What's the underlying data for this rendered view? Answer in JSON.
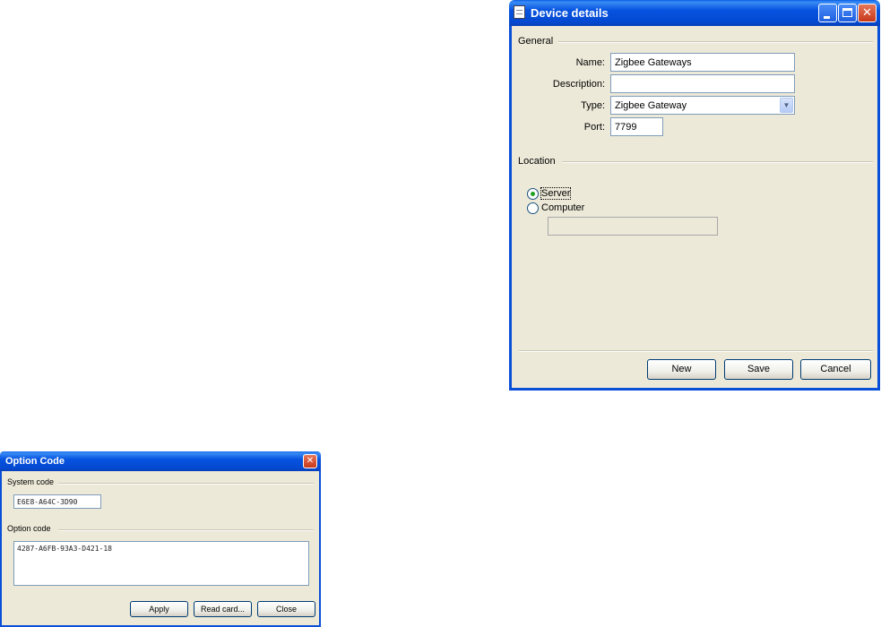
{
  "device_window": {
    "title": "Device details",
    "icon": "document-icon",
    "title_buttons": {
      "minimize": "_",
      "maximize": "□",
      "close": "✕"
    },
    "general": {
      "legend": "General",
      "name": {
        "label": "Name:",
        "value": "Zigbee Gateways"
      },
      "description": {
        "label": "Description:",
        "value": ""
      },
      "type": {
        "label": "Type:",
        "value": "Zigbee Gateway"
      },
      "port": {
        "label": "Port:",
        "value": "7799"
      }
    },
    "location": {
      "legend": "Location",
      "options": [
        {
          "label": "Server",
          "checked": true
        },
        {
          "label": "Computer",
          "checked": false
        }
      ],
      "computer_value": ""
    },
    "buttons": {
      "new": "New",
      "save": "Save",
      "cancel": "Cancel"
    }
  },
  "option_window": {
    "title": "Option Code",
    "close_glyph": "✕",
    "system_code": {
      "legend": "System code",
      "value": "E6E8-A64C-3D90"
    },
    "option_code": {
      "legend": "Option code",
      "value": "4287-A6FB-93A3-D421-18"
    },
    "buttons": {
      "apply": "Apply",
      "read_card": "Read card...",
      "close": "Close"
    }
  },
  "colors": {
    "titlebar_blue": "#0653e0",
    "dialog_face": "#ece9d8",
    "close_red": "#c7391a",
    "radio_green": "#21a121"
  }
}
